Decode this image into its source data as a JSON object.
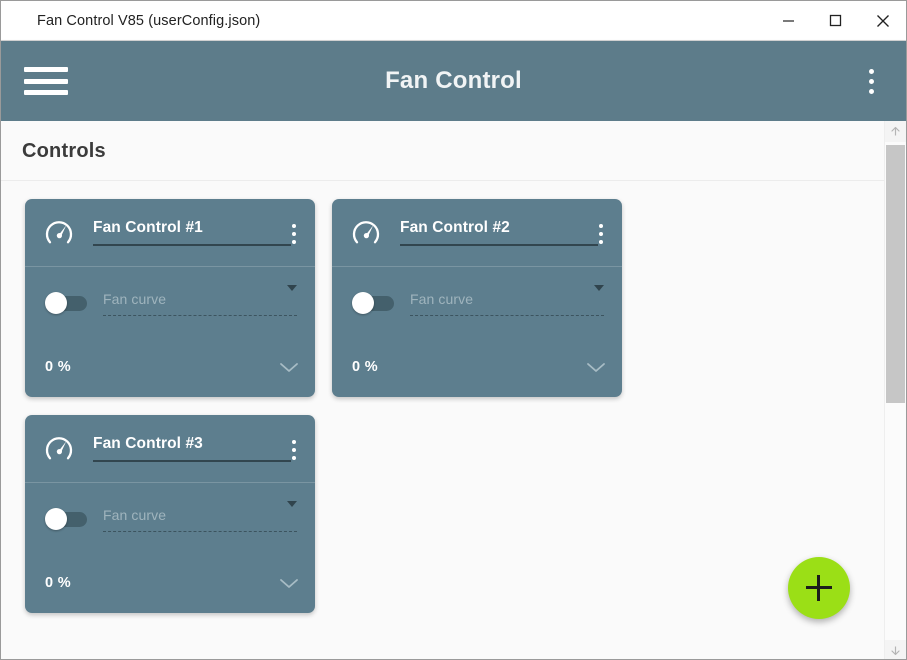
{
  "window": {
    "title": "Fan Control V85 (userConfig.json)",
    "controls": {
      "minimize_label": "Minimize",
      "maximize_label": "Maximize",
      "close_label": "Close"
    }
  },
  "appbar": {
    "menu_label": "Menu",
    "title": "Fan Control",
    "overflow_label": "More options"
  },
  "section": {
    "title": "Controls"
  },
  "cards": [
    {
      "icon": "gauge-icon",
      "name": "Fan Control #1",
      "overflow_label": "More options",
      "toggle_state": "off",
      "curve_placeholder": "Fan curve",
      "curve_value": "",
      "percent": "0 %"
    },
    {
      "icon": "gauge-icon",
      "name": "Fan Control #2",
      "overflow_label": "More options",
      "toggle_state": "off",
      "curve_placeholder": "Fan curve",
      "curve_value": "",
      "percent": "0 %"
    },
    {
      "icon": "gauge-icon",
      "name": "Fan Control #3",
      "overflow_label": "More options",
      "toggle_state": "off",
      "curve_placeholder": "Fan curve",
      "curve_value": "",
      "percent": "0 %"
    }
  ],
  "fab": {
    "label": "+",
    "name": "add-control-button",
    "color": "#9bdf16"
  },
  "scrollbar": {
    "up_label": "Scroll up",
    "down_label": "Scroll down"
  },
  "colors": {
    "appbar": "#5d7c8a",
    "card": "#5d7e8e",
    "content_bg": "#fafafa",
    "accent": "#9bdf16",
    "card_underline": "#32464f",
    "placeholder_text": "#9fb4bd"
  }
}
